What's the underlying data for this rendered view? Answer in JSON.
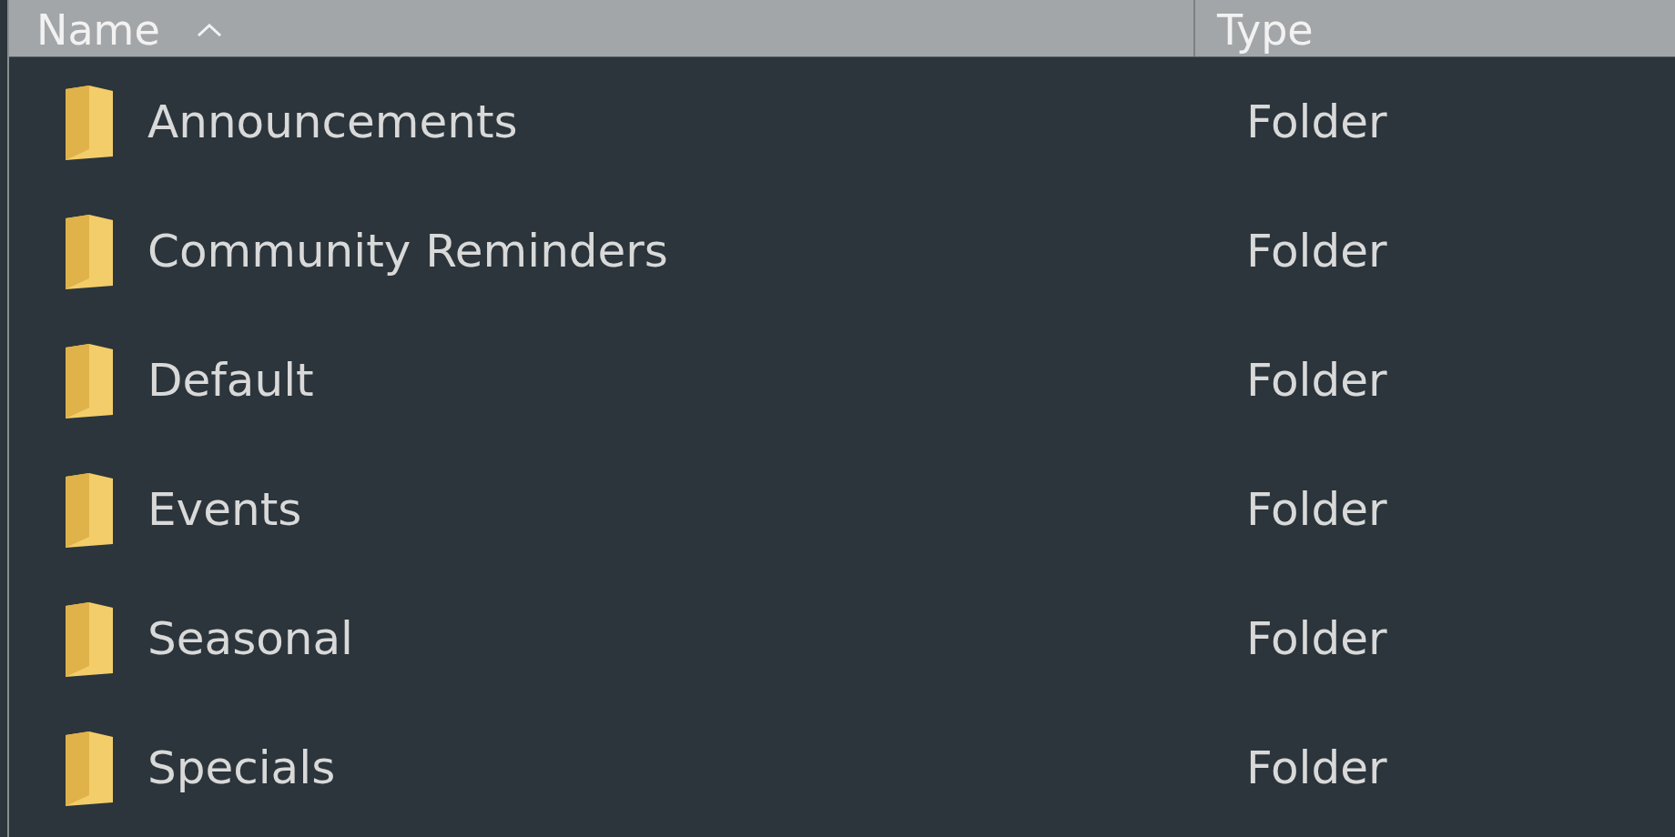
{
  "table": {
    "columns": [
      {
        "label": "Name",
        "sorted": true
      },
      {
        "label": "Type",
        "sorted": false
      }
    ],
    "rows": [
      {
        "name": "Announcements",
        "type": "Folder"
      },
      {
        "name": "Community Reminders",
        "type": "Folder"
      },
      {
        "name": "Default",
        "type": "Folder"
      },
      {
        "name": "Events",
        "type": "Folder"
      },
      {
        "name": "Seasonal",
        "type": "Folder"
      },
      {
        "name": "Specials",
        "type": "Folder"
      }
    ]
  }
}
